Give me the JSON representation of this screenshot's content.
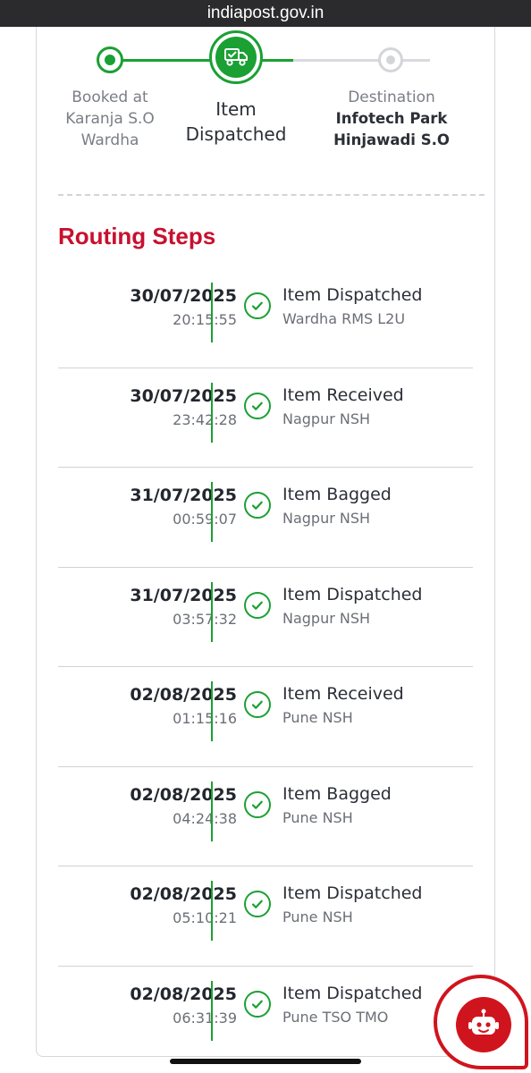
{
  "browser": {
    "url": "indiapost.gov.in"
  },
  "tracker": {
    "booked_label": "Booked at",
    "booked_office": "Karanja S.O",
    "booked_city": "Wardha",
    "current_line1": "Item",
    "current_line2": "Dispatched",
    "current_icon": "delivery-truck-icon",
    "destination_label": "Destination",
    "destination_line1": "Infotech Park",
    "destination_line2": "Hinjawadi S.O"
  },
  "section_title": "Routing Steps",
  "steps": [
    {
      "date": "30/07/2025",
      "time": "20:15:55",
      "event": "Item Dispatched",
      "office": "Wardha RMS L2U"
    },
    {
      "date": "30/07/2025",
      "time": "23:42:28",
      "event": "Item Received",
      "office": "Nagpur NSH"
    },
    {
      "date": "31/07/2025",
      "time": "00:59:07",
      "event": "Item Bagged",
      "office": "Nagpur NSH"
    },
    {
      "date": "31/07/2025",
      "time": "03:57:32",
      "event": "Item Dispatched",
      "office": "Nagpur NSH"
    },
    {
      "date": "02/08/2025",
      "time": "01:15:16",
      "event": "Item Received",
      "office": "Pune NSH"
    },
    {
      "date": "02/08/2025",
      "time": "04:24:38",
      "event": "Item Bagged",
      "office": "Pune NSH"
    },
    {
      "date": "02/08/2025",
      "time": "05:10:21",
      "event": "Item Dispatched",
      "office": "Pune NSH"
    },
    {
      "date": "02/08/2025",
      "time": "06:31:39",
      "event": "Item Dispatched",
      "office": "Pune TSO TMO"
    }
  ],
  "chatbot": {
    "icon": "robot-icon"
  },
  "colors": {
    "accent_green": "#1aa033",
    "brand_red": "#c8102e",
    "chatbot_red": "#d0141e"
  }
}
